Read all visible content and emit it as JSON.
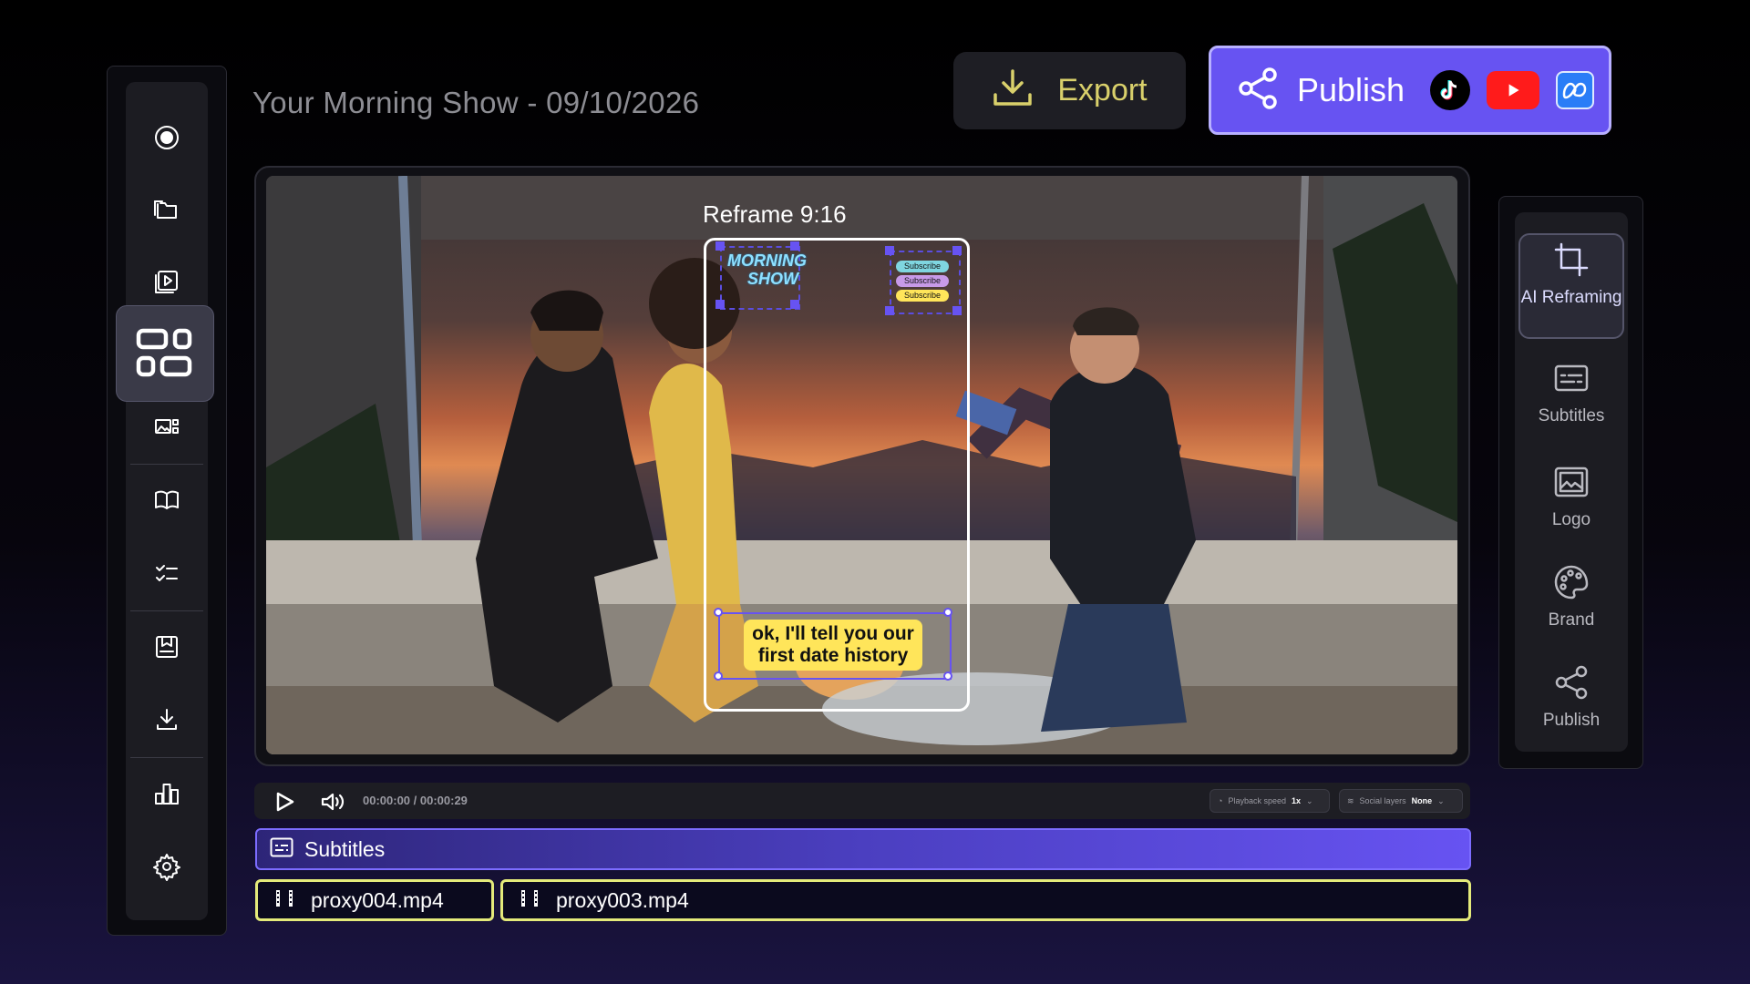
{
  "project": {
    "title": "Your Morning Show - 09/10/2026"
  },
  "header": {
    "export_label": "Export",
    "publish_label": "Publish",
    "platforms": [
      "tiktok-icon",
      "youtube-icon",
      "meta-icon"
    ]
  },
  "sidebar": {
    "items": [
      {
        "icon": "record-icon"
      },
      {
        "icon": "folders-icon"
      },
      {
        "icon": "video-library-icon"
      },
      {
        "icon": "layout-grid-icon",
        "active": true
      },
      {
        "icon": "media-gallery-icon"
      },
      {
        "icon": "book-icon"
      },
      {
        "icon": "checklist-icon"
      },
      {
        "icon": "bookmark-icon"
      },
      {
        "icon": "download-icon"
      },
      {
        "icon": "analytics-icon"
      },
      {
        "icon": "settings-icon"
      }
    ]
  },
  "preview": {
    "reframe_label": "Reframe 9:16",
    "logo_text_line1": "MORNING",
    "logo_text_line2": "SHOW",
    "subscribe_pills": [
      "Subscribe",
      "Subscribe",
      "Subscribe"
    ],
    "caption": "ok, I'll tell you our first date history"
  },
  "right_panel": {
    "items": [
      {
        "icon": "crop-icon",
        "label": "AI Reframing",
        "active": true
      },
      {
        "icon": "subtitles-icon",
        "label": "Subtitles"
      },
      {
        "icon": "image-icon",
        "label": "Logo"
      },
      {
        "icon": "palette-icon",
        "label": "Brand"
      },
      {
        "icon": "share-icon",
        "label": "Publish"
      }
    ]
  },
  "playback": {
    "timecode": "00:00:00 / 00:00:29",
    "speed_label": "Playback speed",
    "speed_value": "1x",
    "social_label": "Social layers",
    "social_value": "None"
  },
  "timeline": {
    "subtitle_track_label": "Subtitles",
    "clips": [
      {
        "name": "proxy004.mp4"
      },
      {
        "name": "proxy003.mp4"
      }
    ]
  },
  "colors": {
    "accent": "#6753f2",
    "export_text": "#d9d06b",
    "clip_border": "#e4ea7a",
    "caption_bg": "#ffe55a"
  }
}
